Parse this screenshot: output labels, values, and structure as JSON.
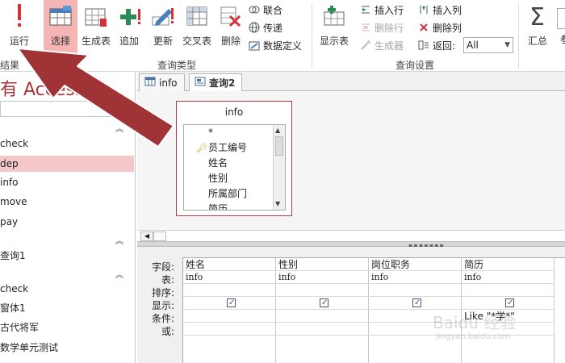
{
  "ribbon": {
    "buttons": {
      "run": "运行",
      "select": "选择",
      "make_table": "生成表",
      "append": "追加",
      "update": "更新",
      "crosstab": "交叉表",
      "delete": "删除",
      "show_table": "显示表",
      "totals": "汇总"
    },
    "small": {
      "union": "联合",
      "passthrough": "传递",
      "data_definition": "数据定义",
      "insert_row": "插入行",
      "delete_row": "删除行",
      "builder": "生成器",
      "insert_col": "插入列",
      "delete_col": "删除列",
      "return_label": "返回:",
      "return_value": "All"
    },
    "groups": {
      "results": "结果",
      "query_type": "查询类型",
      "query_setup": "查询设置"
    }
  },
  "nav": {
    "title": "有 Access",
    "items": [
      "check",
      "dep",
      "info",
      "move",
      "pay"
    ],
    "query_items": [
      "查询1"
    ],
    "form_items": [
      "check",
      "窗体1",
      "古代将军",
      "数学单元测试"
    ]
  },
  "tabs": [
    {
      "label": "info"
    },
    {
      "label": "查询2"
    }
  ],
  "table_box": {
    "title": "info",
    "fields": [
      "*",
      "员工编号",
      "姓名",
      "性别",
      "所属部门",
      "简历"
    ]
  },
  "qbe": {
    "row_labels": [
      "字段:",
      "表:",
      "排序:",
      "显示:",
      "条件:",
      "或:"
    ],
    "columns": [
      {
        "field": "姓名",
        "table": "info",
        "show": true,
        "criteria": ""
      },
      {
        "field": "性别",
        "table": "info",
        "show": true,
        "criteria": ""
      },
      {
        "field": "岗位职务",
        "table": "info",
        "show": true,
        "criteria": ""
      },
      {
        "field": "简历",
        "table": "info",
        "show": true,
        "criteria": "Like \"*学*\""
      }
    ]
  },
  "watermark": {
    "text": "Baidu 经验",
    "url": "jingyan.baidu.com"
  },
  "colors": {
    "accent": "#a4373a",
    "arrow": "#a03336",
    "selected": "#f6b5b5"
  }
}
